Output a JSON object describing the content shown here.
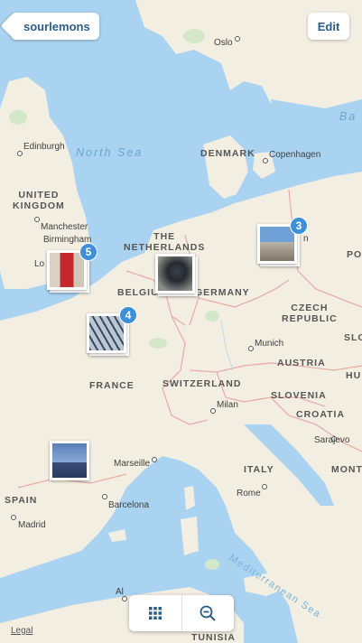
{
  "header": {
    "back_label": "sourlemons",
    "edit_label": "Edit"
  },
  "map": {
    "seas": {
      "north_sea": "North Sea",
      "baltic_partial": "Ba",
      "mediterranean": "Mediterranean Sea"
    },
    "countries": {
      "uk_line1": "UNITED",
      "uk_line2": "KINGDOM",
      "denmark": "DENMARK",
      "netherlands_line1": "THE",
      "netherlands_line2": "NETHERLANDS",
      "belgium": "BELGIU",
      "germany": "GERMANY",
      "czech_line1": "CZECH",
      "czech_line2": "REPUBLIC",
      "poland_partial": "PO",
      "slovakia_partial": "SLO",
      "austria": "AUSTRIA",
      "hungary_partial": "HU",
      "france": "FRANCE",
      "switzerland": "SWITZERLAND",
      "slovenia": "SLOVENIA",
      "croatia": "CROATIA",
      "italy": "ITALY",
      "montenegro_partial": "MONT",
      "spain": "SPAIN",
      "tunisia": "TUNISIA"
    },
    "cities": {
      "oslo": "Oslo",
      "edinburgh": "Edinburgh",
      "copenhagen": "Copenhagen",
      "manchester": "Manchester",
      "birmingham": "Birmingham",
      "london_partial": "Lo",
      "berlin_partial": "n",
      "munich": "Munich",
      "milan": "Milan",
      "marseille": "Marseille",
      "sarajevo": "Sarajevo",
      "rome": "Rome",
      "barcelona": "Barcelona",
      "madrid": "Madrid",
      "algiers_partial": "Al"
    }
  },
  "clusters": [
    {
      "id": "london",
      "count": "5",
      "subject": "red-phone-booth"
    },
    {
      "id": "brussels",
      "count": "",
      "subject": "car-interior"
    },
    {
      "id": "berlin",
      "count": "3",
      "subject": "palace-building"
    },
    {
      "id": "paris",
      "count": "4",
      "subject": "metal-structure"
    },
    {
      "id": "spain-north",
      "count": "",
      "subject": "castle-silhouette"
    }
  ],
  "toolbar": {
    "grid_icon": "grid-icon",
    "zoom_out_icon": "zoom-out-icon"
  },
  "footer": {
    "legal_label": "Legal"
  },
  "colors": {
    "water": "#a9d3f0",
    "land": "#f3eee2",
    "border": "#e8a8a8",
    "accent": "#3d8fd8",
    "button_text": "#2b5d8a"
  }
}
